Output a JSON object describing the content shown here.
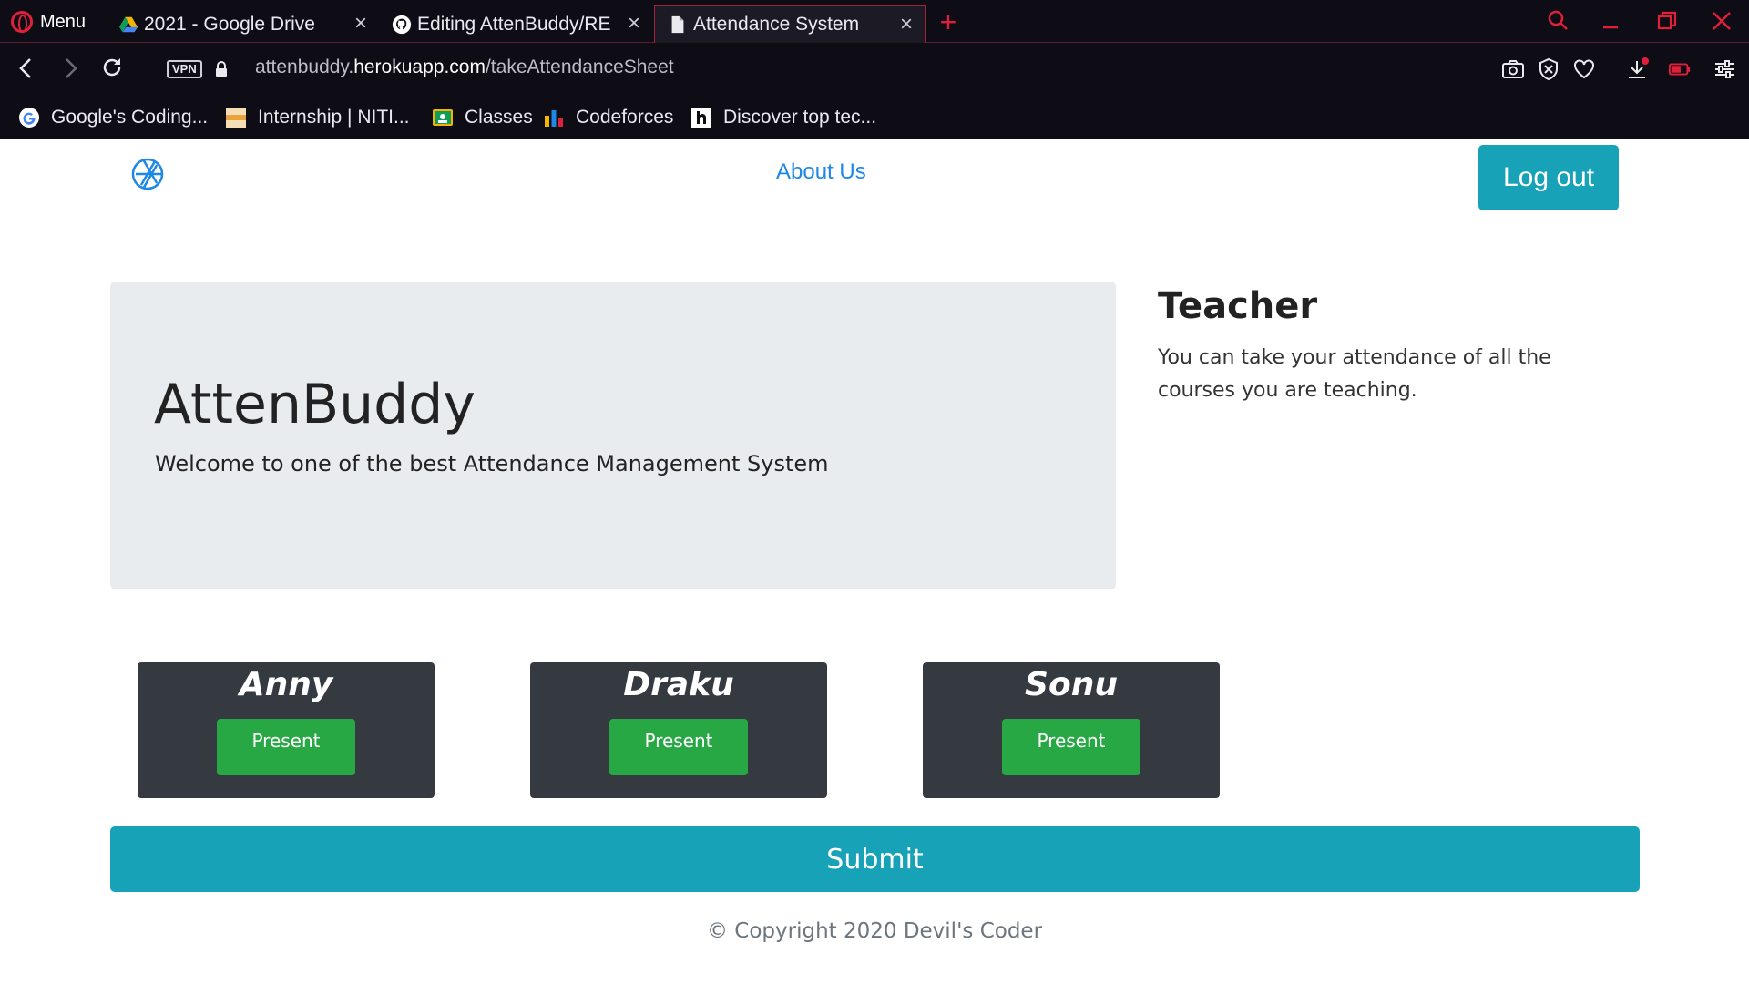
{
  "browser": {
    "menu_label": "Menu",
    "tabs": [
      {
        "title": "2021 - Google Drive",
        "icon": "google-drive-icon"
      },
      {
        "title": "Editing AttenBuddy/RE",
        "icon": "github-icon"
      },
      {
        "title": "Attendance System",
        "icon": "document-icon",
        "active": true
      }
    ],
    "vpn_label": "VPN",
    "url_domain_prefix": "attenbuddy.",
    "url_domain": "herokuapp.com",
    "url_path": "/takeAttendanceSheet",
    "bookmarks": [
      {
        "label": "Google's Coding...",
        "icon": "google-icon"
      },
      {
        "label": "Internship | NITI...",
        "icon": "niti-icon"
      },
      {
        "label": "Classes",
        "icon": "classroom-icon"
      },
      {
        "label": "Codeforces",
        "icon": "codeforces-icon"
      },
      {
        "label": "Discover top tec...",
        "icon": "hashnode-icon"
      }
    ]
  },
  "navbar": {
    "about_label": "About Us",
    "logout_label": "Log out"
  },
  "jumbotron": {
    "title": "AttenBuddy",
    "subtitle": "Welcome to one of the best Attendance Management System"
  },
  "teacher": {
    "title": "Teacher",
    "text": "You can take your attendance of all the courses you are teaching."
  },
  "students": [
    {
      "name": "Anny",
      "button": "Present"
    },
    {
      "name": "Draku",
      "button": "Present"
    },
    {
      "name": "Sonu",
      "button": "Present"
    }
  ],
  "submit_label": "Submit",
  "footer": {
    "copyright": "© Copyright 2020 Devil's Coder"
  },
  "colors": {
    "accent": "#17a2b8",
    "success": "#28a745",
    "card": "#343a40",
    "link": "#1e88e5",
    "browser_accent": "#e0203a"
  }
}
